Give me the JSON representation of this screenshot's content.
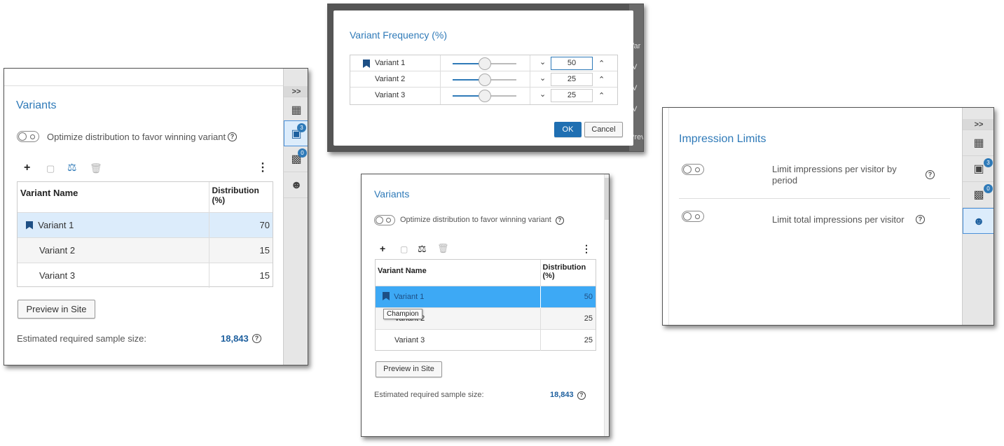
{
  "panel_left": {
    "title": "Variants",
    "optimize_label": "Optimize distribution to favor winning variant",
    "table_headers": [
      "Variant Name",
      "Distribution (%)"
    ],
    "rows": [
      {
        "name": "Variant 1",
        "value": "70"
      },
      {
        "name": "Variant 2",
        "value": "15"
      },
      {
        "name": "Variant 3",
        "value": "15"
      }
    ],
    "preview_label": "Preview in Site",
    "sample_label": "Estimated required sample size:",
    "sample_value": "18,843"
  },
  "rail": {
    "collapse": ">>",
    "variants_badge": "3",
    "creatives_badge": "0"
  },
  "dialog": {
    "title": "Variant Frequency (%)",
    "rows": [
      {
        "name": "Variant 1",
        "value": "50",
        "fraction": 0.5
      },
      {
        "name": "Variant 2",
        "value": "25",
        "fraction": 0.5
      },
      {
        "name": "Variant 3",
        "value": "25",
        "fraction": 0.5
      }
    ],
    "ok_label": "OK",
    "cancel_label": "Cancel",
    "bg_fragments": [
      "Var",
      "V",
      "V",
      "V",
      "Prev"
    ]
  },
  "panel_mid": {
    "title": "Variants",
    "optimize_label": "Optimize distribution to favor winning variant",
    "table_headers": [
      "Variant Name",
      "Distribution (%)"
    ],
    "rows": [
      {
        "name": "Variant 1",
        "value": "50"
      },
      {
        "name": "Variant 2",
        "value": "25"
      },
      {
        "name": "Variant 3",
        "value": "25"
      }
    ],
    "tooltip": "Champion",
    "preview_label": "Preview in Site",
    "sample_label": "Estimated required sample size:",
    "sample_value": "18,843"
  },
  "panel_right": {
    "title": "Impression Limits",
    "limit_period_label": "Limit impressions per visitor by period",
    "limit_total_label": "Limit total impressions per visitor"
  },
  "colors": {
    "accent": "#2f7ab8",
    "selected_row_light": "#dcecfb",
    "selected_row_strong": "#3da9f5"
  }
}
